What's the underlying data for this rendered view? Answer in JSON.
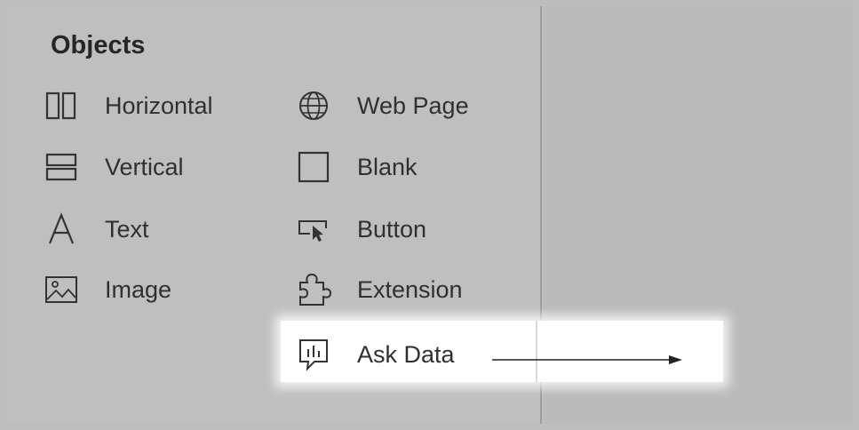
{
  "panel": {
    "title": "Objects",
    "items": [
      {
        "label": "Horizontal",
        "icon": "horizontal-layout-icon"
      },
      {
        "label": "Vertical",
        "icon": "vertical-layout-icon"
      },
      {
        "label": "Text",
        "icon": "text-icon"
      },
      {
        "label": "Image",
        "icon": "image-icon"
      },
      {
        "label": "Web Page",
        "icon": "globe-icon"
      },
      {
        "label": "Blank",
        "icon": "blank-icon"
      },
      {
        "label": "Button",
        "icon": "button-cursor-icon"
      },
      {
        "label": "Extension",
        "icon": "puzzle-icon"
      },
      {
        "label": "Ask Data",
        "icon": "ask-data-icon"
      }
    ]
  },
  "colors": {
    "panel_bg": "#bfbfbf",
    "highlight": "#ffffff",
    "text": "#2b2b2b"
  }
}
